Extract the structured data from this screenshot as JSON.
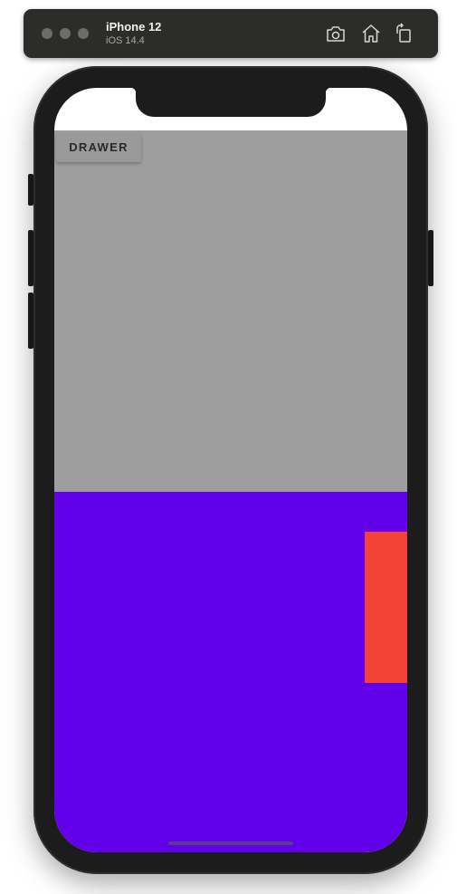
{
  "simulator": {
    "device_name": "iPhone 12",
    "os_version": "iOS 14.4",
    "toolbar_icons": [
      "screenshot-icon",
      "home-icon",
      "rotate-icon"
    ]
  },
  "app": {
    "drawer_button_label": "DRAWER",
    "colors": {
      "top_area": "#9e9e9e",
      "bottom_area": "#6200ea",
      "drawer_panel": "#f44336"
    }
  }
}
